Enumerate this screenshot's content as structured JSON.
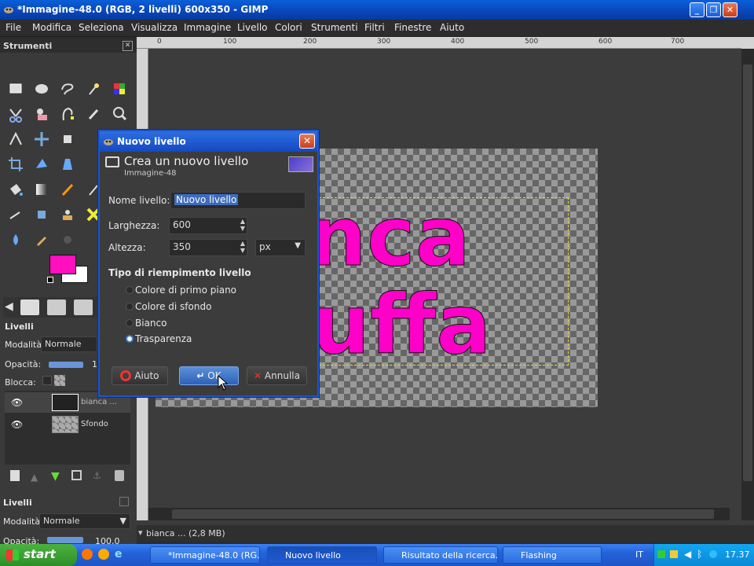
{
  "window": {
    "title": "*Immagine-48.0 (RGB, 2 livelli) 600x350 - GIMP",
    "minimize": "_",
    "maximize": "❐",
    "close": "✕"
  },
  "menubar": {
    "items": [
      "File",
      "Modifica",
      "Seleziona",
      "Visualizza",
      "Immagine",
      "Livello",
      "Colori",
      "Strumenti",
      "Filtri",
      "Finestre",
      "Aiuto"
    ]
  },
  "toolbox": {
    "title": "Strumenti",
    "layers_title": "Livelli",
    "mode_label": "Modalità:",
    "mode_value": "Normale",
    "opacity_label": "Opacità:",
    "opacity_value": "1",
    "lock_label": "Blocca:",
    "layers": [
      {
        "name": "bianca ..."
      },
      {
        "name": "Sfondo"
      }
    ],
    "bottom": {
      "title": "Livelli",
      "mode_label": "Modalità:",
      "mode_value": "Normale",
      "opacity_label": "Opacità:",
      "opacity_value": "100,0"
    },
    "colors": {
      "foreground": "#ff0fbe",
      "background": "#ffffff"
    }
  },
  "rulers": {
    "marks": [
      "0",
      "100",
      "200",
      "300",
      "400",
      "500",
      "600",
      "700"
    ]
  },
  "canvas": {
    "text_line1": "nca",
    "text_line2": "uffa",
    "text_color": "#ff00c8"
  },
  "status": {
    "text": "bianca ... (2,8 MB)"
  },
  "dialog": {
    "title": "Nuovo livello",
    "heading": "Crea un nuovo livello",
    "subheading": "Immagine-48",
    "name_label": "Nome livello:",
    "name_value": "Nuovo livello",
    "width_label": "Larghezza:",
    "width_value": "600",
    "height_label": "Altezza:",
    "height_value": "350",
    "unit": "px",
    "fill_title": "Tipo di riempimento livello",
    "fill_options": [
      "Colore di primo piano",
      "Colore di sfondo",
      "Bianco",
      "Trasparenza"
    ],
    "fill_selected": "Trasparenza",
    "btn_help": "Aiuto",
    "btn_ok": "OK",
    "btn_cancel": "Annulla"
  },
  "taskbar": {
    "start": "start",
    "tasks": [
      {
        "label": "*Immagine-48.0 (RG..."
      },
      {
        "label": "Nuovo livello"
      },
      {
        "label": "Risultato della ricerca..."
      },
      {
        "label": "Flashing"
      }
    ],
    "lang": "IT",
    "clock": "17.37"
  }
}
